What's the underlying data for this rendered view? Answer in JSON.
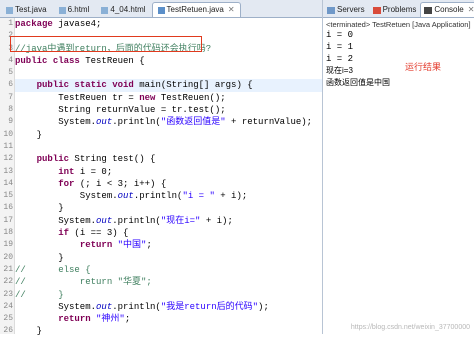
{
  "editor": {
    "tabs": [
      {
        "label": "Test.java",
        "active": false
      },
      {
        "label": "6.html",
        "active": false
      },
      {
        "label": "4_04.html",
        "active": false
      },
      {
        "label": "TestRetuen.java",
        "active": true
      }
    ],
    "lines": [
      {
        "n": "1",
        "t": "package javase4;"
      },
      {
        "n": "2",
        "t": ""
      },
      {
        "n": "3",
        "t": "//java中遇到return，后面的代码还会执行吗?"
      },
      {
        "n": "4",
        "t": "public class TestReuen {"
      },
      {
        "n": "5",
        "t": ""
      },
      {
        "n": "6",
        "t": "    public static void main(String[] args) {"
      },
      {
        "n": "7",
        "t": "        TestReuen tr = new TestReuen();"
      },
      {
        "n": "8",
        "t": "        String returnValue = tr.test();"
      },
      {
        "n": "9",
        "t": "        System.out.println(\"函数返回值是\" + returnValue);"
      },
      {
        "n": "10",
        "t": "    }"
      },
      {
        "n": "11",
        "t": ""
      },
      {
        "n": "12",
        "t": "    public String test() {"
      },
      {
        "n": "13",
        "t": "        int i = 0;"
      },
      {
        "n": "14",
        "t": "        for (; i < 3; i++) {"
      },
      {
        "n": "15",
        "t": "            System.out.println(\"i = \" + i);"
      },
      {
        "n": "16",
        "t": "        }"
      },
      {
        "n": "17",
        "t": "        System.out.println(\"现在i=\" + i);"
      },
      {
        "n": "18",
        "t": "        if (i == 3) {"
      },
      {
        "n": "19",
        "t": "            return \"中国\";"
      },
      {
        "n": "20",
        "t": "        }"
      },
      {
        "n": "21",
        "t": "//      else {"
      },
      {
        "n": "22",
        "t": "//          return \"华夏\";"
      },
      {
        "n": "23",
        "t": "//      }"
      },
      {
        "n": "24",
        "t": "        System.out.println(\"我是return后的代码\");"
      },
      {
        "n": "25",
        "t": "        return \"神州\";"
      },
      {
        "n": "26",
        "t": "    }"
      }
    ]
  },
  "console": {
    "tabs": [
      {
        "label": "Servers",
        "icon": "servers-icon"
      },
      {
        "label": "Problems",
        "icon": "problems-icon"
      },
      {
        "label": "Console",
        "icon": "console-icon",
        "active": true
      }
    ],
    "terminated": "<terminated> TestRetuen [Java Application]",
    "output": [
      "i = 0",
      "i = 1",
      "i = 2",
      "现在i=3",
      "函数返回值是中国"
    ],
    "annotation": "运行结果"
  },
  "watermark": "https://blog.csdn.net/weixin_37700000"
}
